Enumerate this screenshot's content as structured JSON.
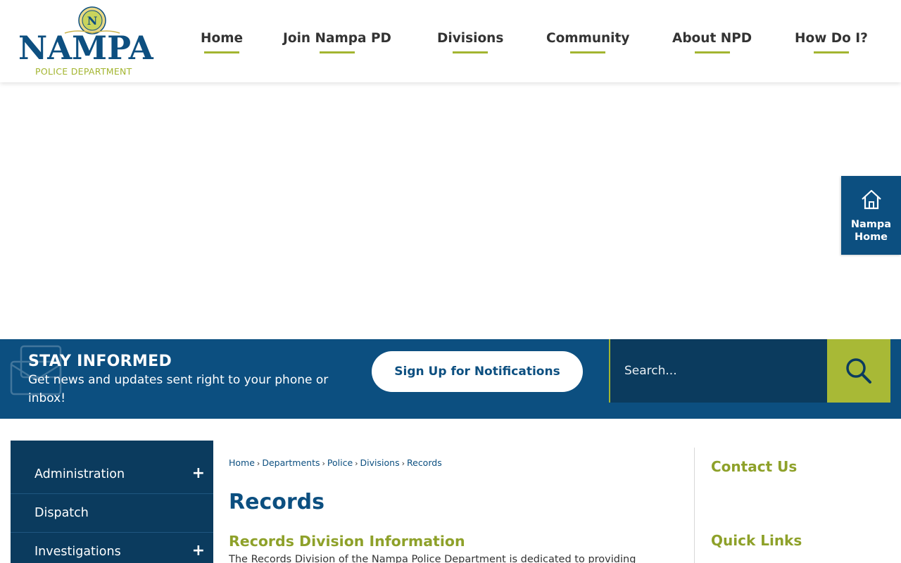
{
  "header": {
    "logo": {
      "seal_letter": "N",
      "wordmark": "NAMPA",
      "subtitle": "POLICE DEPARTMENT"
    },
    "nav": [
      {
        "label": "Home"
      },
      {
        "label": "Join Nampa PD"
      },
      {
        "label": "Divisions"
      },
      {
        "label": "Community"
      },
      {
        "label": "About NPD"
      },
      {
        "label": "How Do I?"
      }
    ]
  },
  "side_tab": {
    "icon": "house-icon",
    "label_line1": "Nampa",
    "label_line2": "Home"
  },
  "stay_informed": {
    "icon": "envelope-icon",
    "title": "STAY INFORMED",
    "text": "Get news and updates sent right to your phone or inbox!",
    "button_label": "Sign Up for Notifications",
    "search_placeholder": "Search...",
    "search_icon": "search-icon"
  },
  "sidenav": {
    "items": [
      {
        "label": "Administration",
        "expand": "+"
      },
      {
        "label": "Dispatch",
        "expand": ""
      },
      {
        "label": "Investigations",
        "expand": "+"
      }
    ]
  },
  "breadcrumb": [
    "Home",
    "Departments",
    "Police",
    "Divisions",
    "Records"
  ],
  "breadcrumb_separator": "›",
  "main": {
    "title": "Records",
    "section_title": "Records Division Information",
    "intro": "The Records Division of the Nampa Police Department is dedicated to providing"
  },
  "right_column": {
    "contact_title": "Contact Us",
    "quick_links_title": "Quick Links"
  },
  "colors": {
    "brand_blue": "#0c4f80",
    "dark_blue": "#0b3b5e",
    "accent_green": "#a3b530"
  }
}
